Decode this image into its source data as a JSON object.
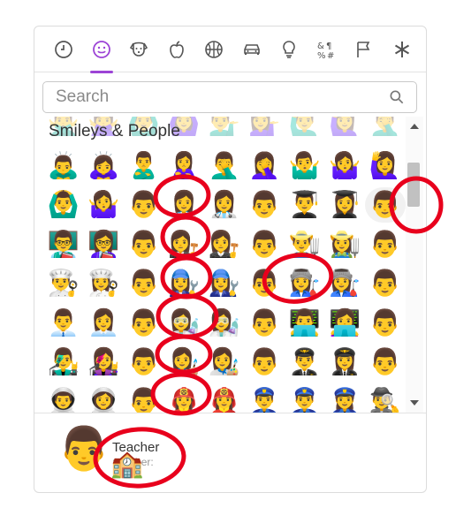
{
  "tabs": [
    {
      "label": "Recent",
      "icon": "clock-icon",
      "active": false
    },
    {
      "label": "Smileys & People",
      "icon": "smiley-icon",
      "active": true
    },
    {
      "label": "Animals & Nature",
      "icon": "dog-icon",
      "active": false
    },
    {
      "label": "Food & Drink",
      "icon": "apple-icon",
      "active": false
    },
    {
      "label": "Activity",
      "icon": "basketball-icon",
      "active": false
    },
    {
      "label": "Travel & Places",
      "icon": "car-icon",
      "active": false
    },
    {
      "label": "Objects",
      "icon": "lightbulb-icon",
      "active": false
    },
    {
      "label": "Symbols",
      "icon": "symbols-icon",
      "active": false
    },
    {
      "label": "Flags",
      "icon": "flag-icon",
      "active": false
    },
    {
      "label": "Custom",
      "icon": "asterisk-icon",
      "active": false
    }
  ],
  "search": {
    "placeholder": "Search",
    "value": ""
  },
  "category_title": "Smileys & People",
  "ghost_row": [
    "🙅‍♂️",
    "🙅‍♀️",
    "🙆‍♂️",
    "🙆‍♀️",
    "💁‍♂️",
    "💁‍♀️",
    "🙋‍♂️",
    "🙋‍♀️",
    "🤦‍♂️"
  ],
  "emoji_rows": [
    [
      "🙇‍♂️",
      "🙇‍♀️",
      "🙎‍♂️",
      "🙎‍♀️",
      "🤦‍♂️",
      "🤦‍♀️",
      "🤷‍♂️",
      "🤷‍♀️",
      "🙋‍♀️"
    ],
    [
      "🙆‍♂️",
      "🤷‍♀️",
      "👨",
      "👩‍⚕️",
      "👩‍⚕️",
      "👨",
      "👨‍🎓",
      "👩‍🎓",
      "👨"
    ],
    [
      "👨‍🏫",
      "👩‍🏫",
      "👨",
      "👩‍⚖️",
      "👩‍⚖️",
      "👨",
      "👨‍🌾",
      "👩‍🌾",
      "👨"
    ],
    [
      "👨‍🍳",
      "👩‍🍳",
      "👨",
      "👩‍🔧",
      "👩‍🔧",
      "👨",
      "👩‍🏭",
      "👩‍🏭",
      "👨"
    ],
    [
      "👨‍💼",
      "👩‍💼",
      "👨",
      "👩‍🔬",
      "👩‍🔬",
      "👨",
      "👨‍💻",
      "👩‍💻",
      "👨"
    ],
    [
      "👨‍🎤",
      "👩‍🎤",
      "👨",
      "👩‍🎨",
      "👩‍🎨",
      "👨",
      "👨‍✈️",
      "👩‍✈️",
      "👨"
    ],
    [
      "👨‍🚀",
      "👩‍🚀",
      "👨",
      "👩‍🚒",
      "👩‍🚒",
      "👮‍♂️",
      "👮‍♂️",
      "👮‍♀️",
      "🕵️‍♂️"
    ]
  ],
  "preview": {
    "emoji": "👨",
    "name": "Teacher",
    "code": ":teacher:",
    "extra_emoji": "🏫"
  },
  "colors": {
    "accent": "#9c44d6",
    "annotation": "#e8001c"
  }
}
